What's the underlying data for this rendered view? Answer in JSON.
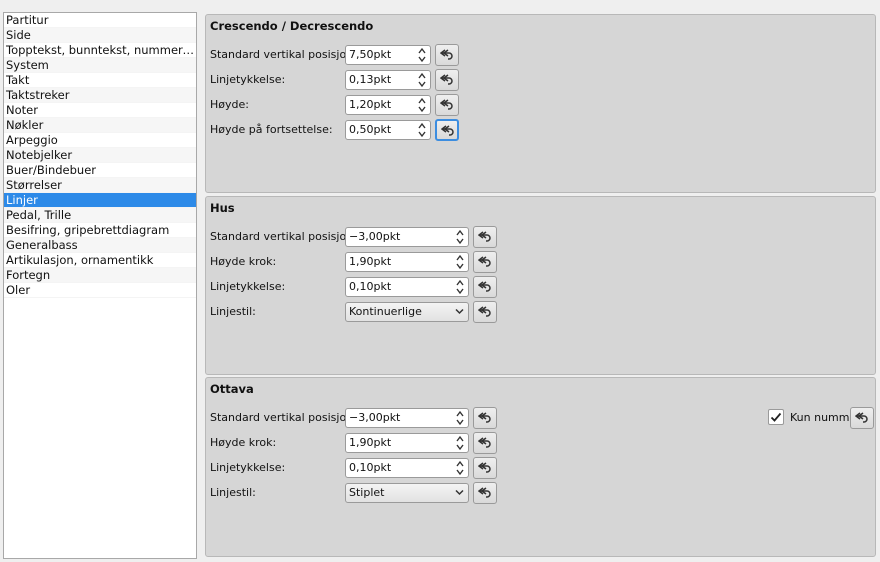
{
  "sidebar": {
    "items": [
      {
        "label": "Partitur"
      },
      {
        "label": "Side"
      },
      {
        "label": "Topptekst, bunntekst, nummereri…"
      },
      {
        "label": "System"
      },
      {
        "label": "Takt"
      },
      {
        "label": "Taktstreker"
      },
      {
        "label": "Noter"
      },
      {
        "label": "Nøkler"
      },
      {
        "label": "Arpeggio"
      },
      {
        "label": "Notebjelker"
      },
      {
        "label": "Buer/Bindebuer"
      },
      {
        "label": "Størrelser"
      },
      {
        "label": "Linjer"
      },
      {
        "label": "Pedal, Trille"
      },
      {
        "label": "Besifring, gripebrettdiagram"
      },
      {
        "label": "Generalbass"
      },
      {
        "label": "Artikulasjon, ornamentikk"
      },
      {
        "label": "Fortegn"
      },
      {
        "label": "Oler"
      }
    ],
    "selected_label": "Linjer"
  },
  "hairpin": {
    "title": "Crescendo / Decrescendo",
    "fields": [
      {
        "label": "Standard vertikal posisjon:",
        "value": "7,50pkt"
      },
      {
        "label": "Linjetykkelse:",
        "value": "0,13pkt"
      },
      {
        "label": "Høyde:",
        "value": "1,20pkt"
      },
      {
        "label": "Høyde på fortsettelse:",
        "value": "0,50pkt"
      }
    ]
  },
  "hus": {
    "title": "Hus",
    "fields": [
      {
        "label": "Standard vertikal posisjon:",
        "value": "−3,00pkt"
      },
      {
        "label": "Høyde krok:",
        "value": "1,90pkt"
      },
      {
        "label": "Linjetykkelse:",
        "value": "0,10pkt"
      },
      {
        "label": "Linjestil:",
        "value": "Kontinuerlige"
      }
    ]
  },
  "ottava": {
    "title": "Ottava",
    "fields": [
      {
        "label": "Standard vertikal posisjon:",
        "value": "−3,00pkt"
      },
      {
        "label": "Høyde krok:",
        "value": "1,90pkt"
      },
      {
        "label": "Linjetykkelse:",
        "value": "0,10pkt"
      },
      {
        "label": "Linjestil:",
        "value": "Stiplet"
      }
    ],
    "numbers_only": {
      "label": "Kun nummer",
      "checked": true
    }
  },
  "icons": {
    "reset": "reset-undo-icon",
    "spin": "spin-arrows-icon",
    "dropdown": "chevron-down-icon",
    "check": "checkmark-icon"
  },
  "colors": {
    "selection": "#2d8ae8",
    "focus": "#3c8de0",
    "panel": "#d6d6d6"
  }
}
